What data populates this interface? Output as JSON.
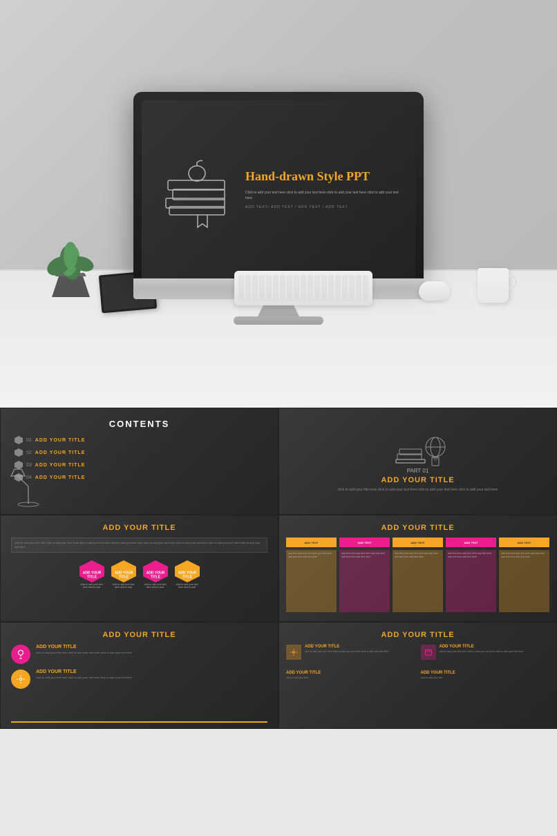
{
  "hero": {
    "slide": {
      "title": "Hand-drawn Style PPT",
      "subtitle": "Click to add your text here click to add your text here click to add your text here click to add your text here",
      "add_text": "ADD TEXT/ ADD TEXT / ADD TEXT / ADD TEXT"
    }
  },
  "slides": [
    {
      "id": "contents",
      "title": "CONTENTS",
      "items": [
        {
          "num": "01",
          "label": "ADD YOUR TITLE"
        },
        {
          "num": "02",
          "label": "ADD YOUR TITLE"
        },
        {
          "num": "03",
          "label": "ADD YOUR TITLE"
        },
        {
          "num": "04",
          "label": "ADD YOUR TITLE"
        }
      ]
    },
    {
      "id": "part01",
      "part_label": "PART 01",
      "title": "ADD YOUR TITLE",
      "desc": "click to add your title here click to add your text here click to add your text here click to add your text here"
    },
    {
      "id": "hexagons",
      "section_title": "ADD YOUR TITLE",
      "body_text": "click to add your text here click to add your text here click to add your text here click to add your text here click to add your text here click to add your text here click to add your text here click to add your text here",
      "items": [
        {
          "label": "ADD YOUR TITLE",
          "color": "pink"
        },
        {
          "label": "ADD YOUR TITLE",
          "color": "yellow"
        },
        {
          "label": "ADD YOUR TITLE",
          "color": "pink"
        },
        {
          "label": "ADD YOUR TITLE",
          "color": "yellow"
        }
      ]
    },
    {
      "id": "columns",
      "section_title": "ADD YOUR TITLE",
      "columns": [
        {
          "header": "ADD TEXT",
          "color": "yellow",
          "text": "add text here add text here add text here add text here add text here add text here"
        },
        {
          "header": "ADD TEXT",
          "color": "pink",
          "text": "add text here add text here add text here add text here add text here add text here"
        },
        {
          "header": "ADD TEXT",
          "color": "yellow",
          "text": "add text here add text here add text here add text here add text here add text here"
        },
        {
          "header": "ADD TEXT",
          "color": "pink",
          "text": "add text here add text here add text here add text here add text here add text here"
        },
        {
          "header": "ADD TEXT",
          "color": "yellow",
          "text": "add text here add text here add text here add text here add text here add text here"
        }
      ]
    },
    {
      "id": "icons-left",
      "section_title": "ADD YOUR TITLE",
      "items": [
        {
          "icon": "💡",
          "color": "pink",
          "title": "ADD YOUR TITLE",
          "desc": "click to add your text here click to add your text here click to add your text here"
        },
        {
          "icon": "⚙",
          "color": "yellow",
          "title": "ADD YOUR TITLE",
          "desc": "click to add your text here click to add your text here click to add your text here"
        }
      ]
    },
    {
      "id": "icons-right",
      "section_title": "ADD YOUR TITLE",
      "items": [
        {
          "icon": "⚙",
          "color": "yellow",
          "title": "ADD YOUR TITLE",
          "desc": "click to add your text here click to add your text here click to add your text here"
        },
        {
          "icon": "🧳",
          "color": "pink",
          "title": "ADD YOUR TITLE",
          "desc": "click to add your text here click to add your text here click to add your text here"
        }
      ],
      "sub_items": [
        {
          "title": "ADD YOUR TITLE",
          "desc": "click to add"
        },
        {
          "title": "ADD YOUR TITLE",
          "desc": "click to add"
        }
      ]
    }
  ],
  "colors": {
    "accent_yellow": "#f5a623",
    "accent_pink": "#e91e8c",
    "dark_bg": "#2d2d2d",
    "text_light": "#aaaaaa",
    "text_dim": "#888888"
  }
}
